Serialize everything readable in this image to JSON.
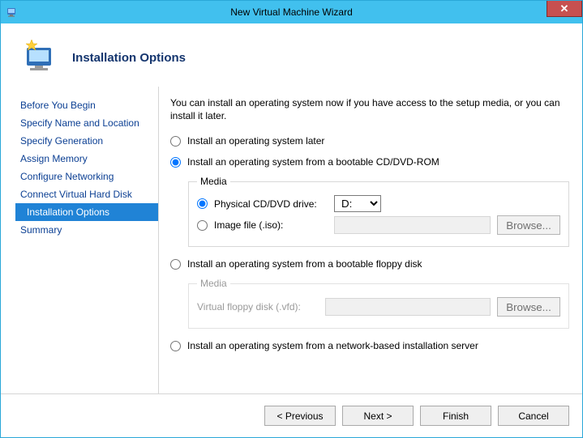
{
  "window": {
    "title": "New Virtual Machine Wizard"
  },
  "header": {
    "title": "Installation Options"
  },
  "sidebar": {
    "steps": [
      {
        "label": "Before You Begin"
      },
      {
        "label": "Specify Name and Location"
      },
      {
        "label": "Specify Generation"
      },
      {
        "label": "Assign Memory"
      },
      {
        "label": "Configure Networking"
      },
      {
        "label": "Connect Virtual Hard Disk"
      },
      {
        "label": "Installation Options"
      },
      {
        "label": "Summary"
      }
    ],
    "selected_index": 6
  },
  "content": {
    "intro": "You can install an operating system now if you have access to the setup media, or you can install it later.",
    "options": {
      "later": "Install an operating system later",
      "cd": "Install an operating system from a bootable CD/DVD-ROM",
      "floppy": "Install an operating system from a bootable floppy disk",
      "network": "Install an operating system from a network-based installation server"
    },
    "selected_option": "cd",
    "cd_media": {
      "legend": "Media",
      "physical_label": "Physical CD/DVD drive:",
      "image_label": "Image file (.iso):",
      "selected": "physical",
      "drive_options": [
        "D:"
      ],
      "drive_selected": "D:",
      "image_path": "",
      "browse_label": "Browse..."
    },
    "floppy_media": {
      "legend": "Media",
      "vfd_label": "Virtual floppy disk (.vfd):",
      "vfd_path": "",
      "browse_label": "Browse..."
    }
  },
  "footer": {
    "previous": "< Previous",
    "next": "Next >",
    "finish": "Finish",
    "cancel": "Cancel"
  }
}
